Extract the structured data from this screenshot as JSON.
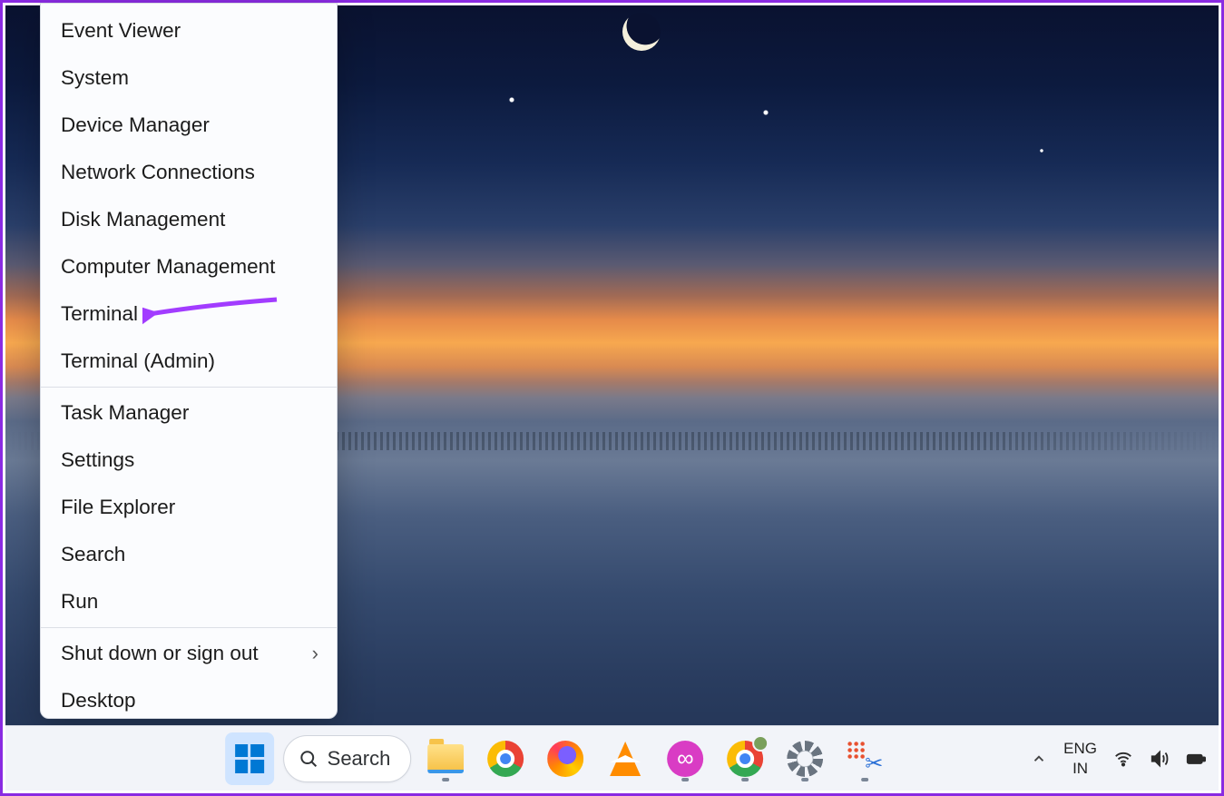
{
  "annotation": {
    "target": "Terminal",
    "arrow_color": "#a23cff"
  },
  "winx_menu": {
    "groups": [
      [
        {
          "label": "Event Viewer",
          "has_sub": false
        },
        {
          "label": "System",
          "has_sub": false
        },
        {
          "label": "Device Manager",
          "has_sub": false
        },
        {
          "label": "Network Connections",
          "has_sub": false
        },
        {
          "label": "Disk Management",
          "has_sub": false
        },
        {
          "label": "Computer Management",
          "has_sub": false
        },
        {
          "label": "Terminal",
          "has_sub": false
        },
        {
          "label": "Terminal (Admin)",
          "has_sub": false
        }
      ],
      [
        {
          "label": "Task Manager",
          "has_sub": false
        },
        {
          "label": "Settings",
          "has_sub": false
        },
        {
          "label": "File Explorer",
          "has_sub": false
        },
        {
          "label": "Search",
          "has_sub": false
        },
        {
          "label": "Run",
          "has_sub": false
        }
      ],
      [
        {
          "label": "Shut down or sign out",
          "has_sub": true
        },
        {
          "label": "Desktop",
          "has_sub": false
        }
      ]
    ]
  },
  "taskbar": {
    "search_label": "Search",
    "pinned": [
      {
        "id": "file-explorer",
        "running": true
      },
      {
        "id": "chrome",
        "running": false
      },
      {
        "id": "firefox",
        "running": false
      },
      {
        "id": "vlc",
        "running": false
      },
      {
        "id": "obs-style-app",
        "running": true
      },
      {
        "id": "chrome-profile",
        "running": true
      },
      {
        "id": "settings",
        "running": true
      },
      {
        "id": "snipping-tool",
        "running": true
      }
    ],
    "tray": {
      "overflow_chevron": "chevron-up-icon",
      "language_line1": "ENG",
      "language_line2": "IN",
      "wifi": "wifi-icon",
      "volume": "volume-icon",
      "battery": "battery-icon"
    }
  }
}
